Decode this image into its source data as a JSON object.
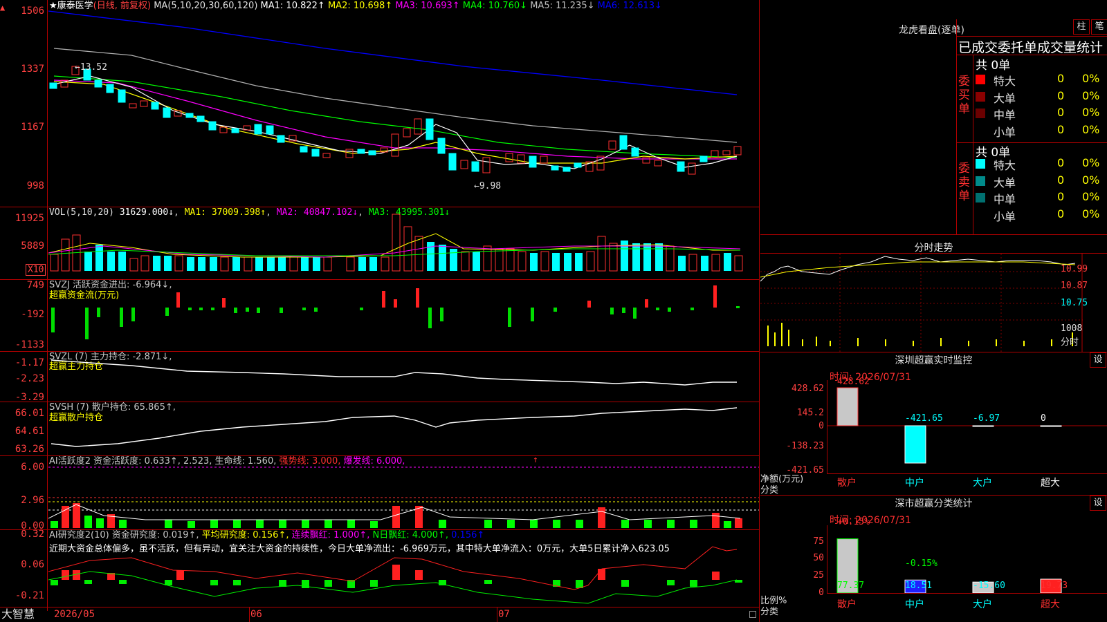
{
  "header": {
    "stock_name": "★康泰医学",
    "period": "(日线, 前复权)",
    "ma_label": "MA(5,10,20,30,60,120)",
    "ma1": "MA1: 10.822↑",
    "ma2": "MA2: 10.698↑",
    "ma3": "MA3: 10.693↑",
    "ma4": "MA4: 10.760↓",
    "ma5": "MA5: 11.235↓",
    "ma6": "MA6: 12.613↓"
  },
  "price_pane": {
    "yticks": [
      "1506",
      "1337",
      "1167",
      "998"
    ],
    "high_label": "←13.52",
    "low_label": "←9.98"
  },
  "vol_pane": {
    "label": "VOL(5,10,20)",
    "value": "31629.000↓",
    "ma1": "MA1: 37009.398↑",
    "ma2": "MA2: 40847.102↓",
    "ma3": "MA3: 43995.301↓",
    "yticks": [
      "11925",
      "5889"
    ],
    "unit": "X10"
  },
  "svzj_pane": {
    "label": "SVZJ  活跃资金进出: -6.964↓,",
    "sub": "超赢资金流(万元)",
    "yticks": [
      "749",
      "-192",
      "-1133"
    ]
  },
  "svzl_pane": {
    "label": "SVZL (7) 主力持仓: -2.871↓,",
    "sub": "超赢主力持仓",
    "yticks": [
      "-1.17",
      "-2.23",
      "-3.29"
    ]
  },
  "svsh_pane": {
    "label": "SVSH (7) 散户持仓: 65.865↑,",
    "sub": "超赢散户持仓",
    "yticks": [
      "66.01",
      "64.61",
      "63.26"
    ]
  },
  "ai_active_pane": {
    "label": "AI活跃度2 资金活跃度: 0.633↑, 2.523, 生命线: 1.560,",
    "strong": "强势线: 3.000,",
    "burst": "爆发线: 6.000,",
    "yticks": [
      "6.00",
      "2.96",
      "0.00"
    ]
  },
  "ai_research_pane": {
    "label": "AI研究度2(10) 资金研究度: 0.019↑,",
    "avg": "平均研究度: 0.156↑,",
    "cont": "连续飘红: 1.000↑,",
    "nday": "N日飘红: 4.000↑,",
    "last": "0.156↑",
    "comment": "近期大资金总体偏多，虽不活跃，但有异动，宜关注大资金的持续性，今日大单净流出：-6.969万元，其中特大单净流入：0万元，大单5日累计净入623.05",
    "yticks": [
      "0.32",
      "0.06",
      "-0.21"
    ]
  },
  "xaxis": {
    "brand": "大智慧",
    "labels": [
      "2026/05",
      "06",
      "07"
    ]
  },
  "dragon": {
    "title": "龙虎看盘(逐单)",
    "btn_bar": "柱",
    "btn_pen": "笔",
    "heading": "已成交委托单成交量统计",
    "buy_label": "委买单",
    "sell_label": "委卖单",
    "buy_total": "共 0单",
    "sell_total": "共 0单",
    "buy_rows": [
      {
        "name": "特大",
        "qty": "0",
        "pct": "0%",
        "color": "#ff0000"
      },
      {
        "name": "大单",
        "qty": "0",
        "pct": "0%",
        "color": "#8b0000"
      },
      {
        "name": "中单",
        "qty": "0",
        "pct": "0%",
        "color": "#6b0000"
      },
      {
        "name": "小单",
        "qty": "0",
        "pct": "0%",
        "color": "#000000"
      }
    ],
    "sell_rows": [
      {
        "name": "特大",
        "qty": "0",
        "pct": "0%",
        "color": "#00ffff"
      },
      {
        "name": "大单",
        "qty": "0",
        "pct": "0%",
        "color": "#008b8b"
      },
      {
        "name": "中单",
        "qty": "0",
        "pct": "0%",
        "color": "#007070"
      },
      {
        "name": "小单",
        "qty": "0",
        "pct": "0%",
        "color": "#000000"
      }
    ]
  },
  "intraday": {
    "title": "分时走势",
    "yticks": [
      "10.99",
      "10.87",
      "10.75"
    ],
    "vol_tick": "1008",
    "vol_unit": "分时"
  },
  "sz_monitor": {
    "title": "深圳超赢实时监控",
    "btn": "设",
    "time": "时间: 2026/07/31",
    "yticks": [
      "428.62",
      "145.2",
      "0",
      "-138.23",
      "-421.65"
    ],
    "ylabel": "净额(万元)",
    "xlabel": "分类",
    "values": [
      "428.62",
      "-421.65",
      "-6.97",
      "0"
    ],
    "categories": [
      "散户",
      "中户",
      "大户",
      "超大"
    ]
  },
  "sz_class": {
    "title": "深市超赢分类统计",
    "btn": "设",
    "time": "时间: 2026/07/31",
    "yticks": [
      "75",
      "50",
      "25",
      "0"
    ],
    "ylabel": "比例%",
    "xlabel": "分类",
    "top_labels": [
      "+0.15%",
      "-0.15%"
    ],
    "values": [
      "77.37",
      "18.51",
      "-15.60",
      "19.73"
    ],
    "categories": [
      "散户",
      "中户",
      "大户",
      "超大"
    ]
  },
  "chart_data": [
    {
      "type": "bar",
      "title": "深圳超赢实时监控",
      "ylabel": "净额(万元)",
      "xlabel": "分类",
      "categories": [
        "散户",
        "中户",
        "大户",
        "超大"
      ],
      "values": [
        428.62,
        -421.65,
        -6.97,
        0
      ],
      "ylim": [
        -421.65,
        428.62
      ]
    },
    {
      "type": "bar",
      "title": "深市超赢分类统计",
      "ylabel": "比例%",
      "xlabel": "分类",
      "categories": [
        "散户",
        "中户",
        "大户",
        "超大"
      ],
      "values": [
        77.37,
        18.51,
        -15.6,
        19.73
      ],
      "ylim": [
        0,
        75
      ]
    }
  ],
  "colors": {
    "up": "#ff3030",
    "down": "#00ffff",
    "frame": "#b00000",
    "axis_text": "#ff4040",
    "ma1": "#ffffff",
    "ma2": "#ffff00",
    "ma3": "#ff00ff",
    "ma4": "#00ff00",
    "ma5": "#c0c0c0",
    "ma6": "#0000ff"
  }
}
